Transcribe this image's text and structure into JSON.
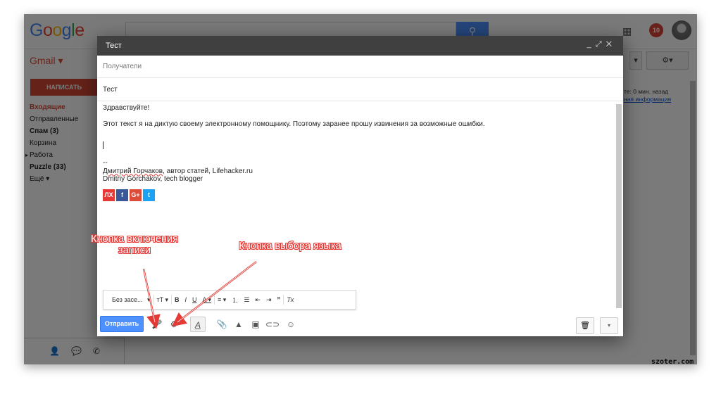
{
  "header": {
    "logo": "Google",
    "notification_count": "10"
  },
  "gmail": {
    "label": "Gmail ▾",
    "compose_button": "НАПИСАТЬ",
    "nav": [
      {
        "label": "Входящие"
      },
      {
        "label": "Отправленные"
      },
      {
        "label": "Спам (3)"
      },
      {
        "label": "Корзина"
      },
      {
        "label": "Работа"
      },
      {
        "label": "Puzzle (33)"
      },
      {
        "label": "Ещё ▾"
      }
    ],
    "right_info_line1": "те: 0 мин. назад",
    "right_info_line2": "ная информация"
  },
  "compose": {
    "title": "Тест",
    "recipients_placeholder": "Получатели",
    "subject": "Тест",
    "greeting": "Здравствуйте!",
    "body_text": "Этот текст я на диктую своему электронному помощнику. Поэтому заранее прошу извинения за возможные ошибки.",
    "sig_dash": "--",
    "sig_line1_name": "Дмитрий Горчаков",
    "sig_line1_rest": ", автор статей, Lifehacker.ru",
    "sig_line2": "Dmitriy Gorchakov, tech blogger",
    "social": [
      {
        "label": "ЛХ",
        "color": "#e53935"
      },
      {
        "label": "f",
        "color": "#3b5998"
      },
      {
        "label": "G+",
        "color": "#dd4b39"
      },
      {
        "label": "t",
        "color": "#1da1f2"
      }
    ],
    "font_selector": "Без засе...",
    "send_button": "Отправить"
  },
  "annotations": {
    "record_button_line1": "Кнопка включения",
    "record_button_line2": "записи",
    "language_button": "Кнопка выбора языка"
  },
  "watermark": "szoter.com"
}
